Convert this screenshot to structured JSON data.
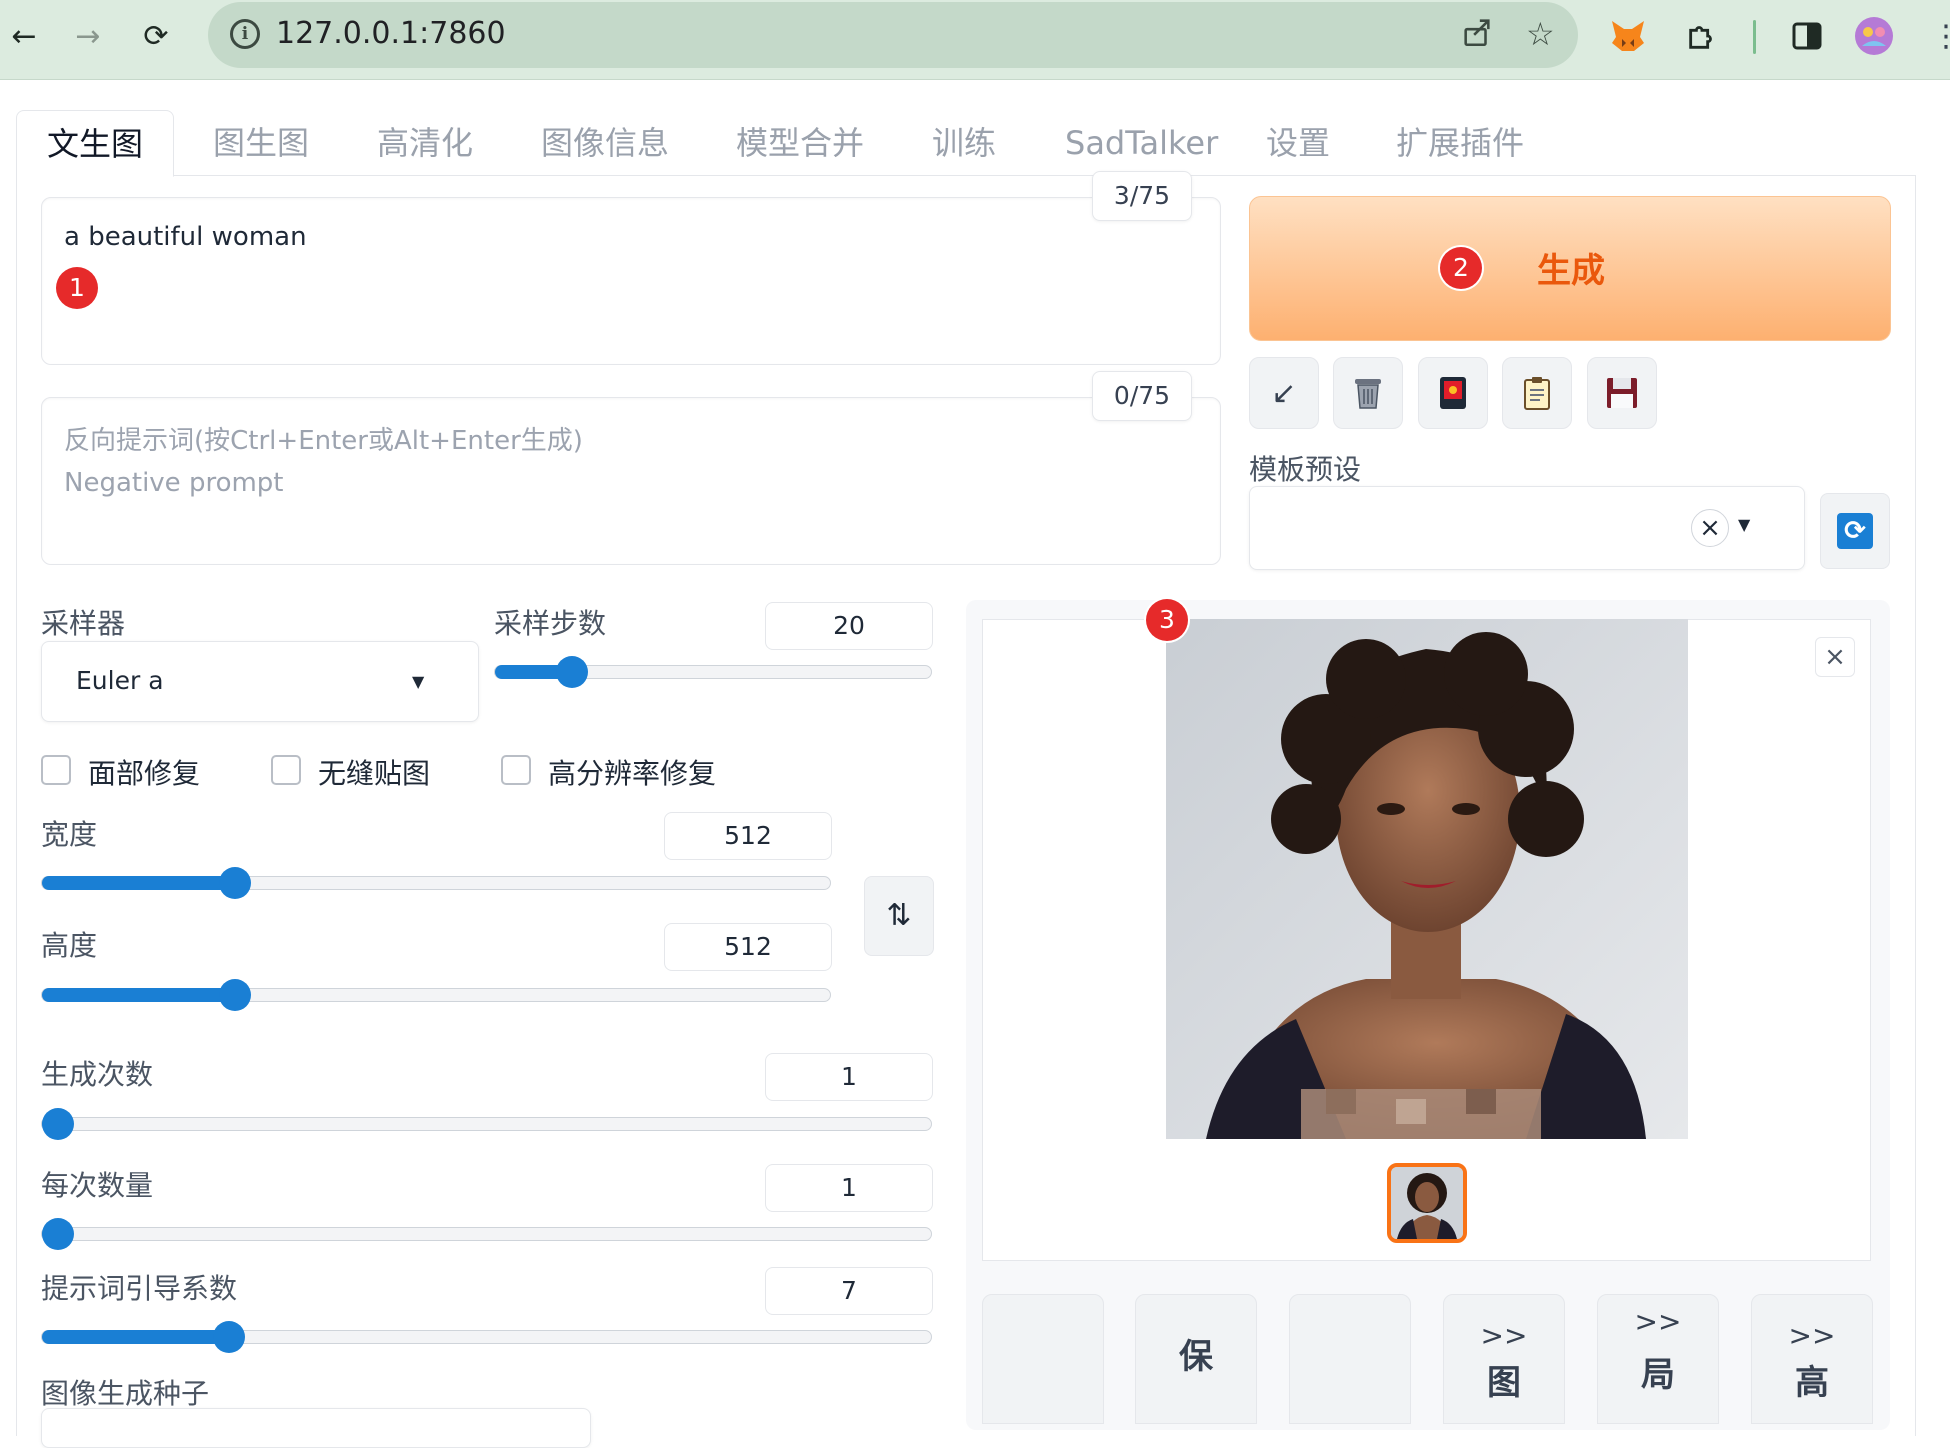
{
  "browser": {
    "url": "127.0.0.1:7860",
    "back_icon": "arrow-left",
    "forward_icon": "arrow-right",
    "reload_icon": "reload",
    "share_icon": "share",
    "bookmark_icon": "star",
    "extensions": [
      "metamask-fox",
      "puzzle-piece",
      "side-panel",
      "profile-avatar"
    ]
  },
  "tabs": [
    "文生图",
    "图生图",
    "高清化",
    "图像信息",
    "模型合并",
    "训练",
    "SadTalker",
    "设置",
    "扩展插件"
  ],
  "prompt": {
    "value": "a beautiful woman",
    "counter": "3/75",
    "badge": "1"
  },
  "negative_prompt": {
    "placeholder_line1": "反向提示词(按Ctrl+Enter或Alt+Enter生成)",
    "placeholder_line2": "Negative prompt",
    "counter": "0/75"
  },
  "generate": {
    "label": "生成",
    "badge": "2",
    "color": "#ea580c"
  },
  "tools": [
    "restore-arrow",
    "trash",
    "red-card",
    "clipboard",
    "floppy-disk"
  ],
  "template": {
    "label": "模板预设",
    "value": "",
    "clear": "×",
    "arrow": "▼",
    "refresh": "⟳"
  },
  "sampler": {
    "label": "采样器",
    "value": "Euler a",
    "arrow": "▼"
  },
  "steps": {
    "label": "采样步数",
    "value": "20",
    "fraction": 0.15
  },
  "checkboxes": [
    {
      "label": "面部修复",
      "checked": false
    },
    {
      "label": "无缝贴图",
      "checked": false
    },
    {
      "label": "高分辨率修复",
      "checked": false
    }
  ],
  "width": {
    "label": "宽度",
    "value": "512",
    "fraction": 0.234
  },
  "height": {
    "label": "高度",
    "value": "512",
    "fraction": 0.234
  },
  "swap": "⇅",
  "batch_count": {
    "label": "生成次数",
    "value": "1",
    "fraction": 0.0
  },
  "batch_size": {
    "label": "每次数量",
    "value": "1",
    "fraction": 0.0
  },
  "cfg": {
    "label": "提示词引导系数",
    "value": "7",
    "fraction": 0.2
  },
  "seed": {
    "label": "图像生成种子"
  },
  "gallery": {
    "badge": "3",
    "close": "×"
  },
  "actions": [
    {
      "top": "",
      "big": ""
    },
    {
      "top": "",
      "big": "保"
    },
    {
      "top": "",
      "big": ""
    },
    {
      "top": ">>",
      "big": "图"
    },
    {
      "top": ">>",
      "big": "局"
    },
    {
      "top": ">>",
      "big": "高"
    }
  ],
  "accent": "#1a7fd4"
}
